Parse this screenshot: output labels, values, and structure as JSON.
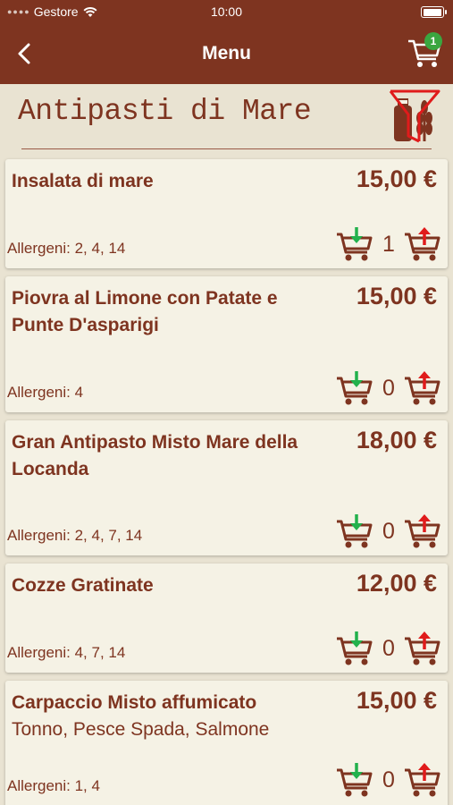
{
  "status_bar": {
    "carrier": "Gestore",
    "time": "10:00",
    "battery_level": 0.95
  },
  "nav": {
    "title": "Menu",
    "cart_count": "1"
  },
  "section": {
    "title": "Antipasti di Mare"
  },
  "items": [
    {
      "name": "Insalata di mare",
      "description": "",
      "price": "15,00 €",
      "allergens": "Allergeni: 2, 4, 14",
      "qty": "1"
    },
    {
      "name": "Piovra al Limone con Patate e Punte D'asparigi",
      "description": "",
      "price": "15,00 €",
      "allergens": "Allergeni: 4",
      "qty": "0"
    },
    {
      "name": "Gran Antipasto Misto Mare della Locanda",
      "description": "",
      "price": "18,00 €",
      "allergens": "Allergeni: 2, 4, 7, 14",
      "qty": "0"
    },
    {
      "name": "Cozze Gratinate",
      "description": "",
      "price": "12,00 €",
      "allergens": "Allergeni: 4, 7, 14",
      "qty": "0"
    },
    {
      "name": "Carpaccio Misto affumicato",
      "description": "Tonno, Pesce Spada, Salmone",
      "price": "15,00 €",
      "allergens": "Allergeni: 1, 4",
      "qty": "0"
    }
  ],
  "colors": {
    "brand": "#7e3420",
    "background": "#e9e3d2",
    "card": "#f5f2e5",
    "remove_arrow": "#22b14c",
    "add_arrow": "#e01b1b",
    "badge": "#3aa640"
  },
  "icons": {
    "back": "chevron-left-icon",
    "cart": "shopping-cart-icon",
    "remove": "cart-remove-icon",
    "add": "cart-add-icon",
    "filter": "allergen-filter-icon"
  }
}
